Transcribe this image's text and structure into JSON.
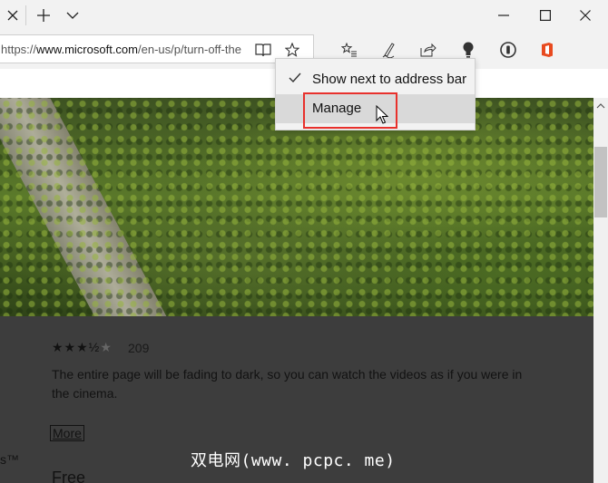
{
  "browser": {
    "url_prefix": "https://",
    "url_host": "www.microsoft.com",
    "url_path": "/en-us/p/turn-off-the"
  },
  "context_menu": {
    "items": [
      {
        "label": "Show next to address bar",
        "checked": true
      },
      {
        "label": "Manage",
        "hovered": true
      }
    ]
  },
  "page": {
    "rating_count": "209",
    "rating_value": 3.5,
    "description": "The entire page will be fading to dark, so you can watch the videos as if you were in the cinema.",
    "more_link": "More",
    "left_fragment": "s™",
    "free_label": "Free",
    "watermark": "双电网(www. pcpc. me)"
  },
  "colors": {
    "highlight": "#e8312c",
    "dark_overlay": "#3d3d3d",
    "chrome_bg": "#f2f2f2"
  },
  "icons": [
    "close-icon",
    "plus-icon",
    "chevron-down-icon",
    "minimize-icon",
    "maximize-icon",
    "window-close-icon",
    "reading-view-icon",
    "star-icon",
    "favorites-icon",
    "pen-icon",
    "share-icon",
    "lightbulb-icon",
    "extension-icon",
    "office-icon",
    "checkmark-icon",
    "cursor-icon"
  ]
}
